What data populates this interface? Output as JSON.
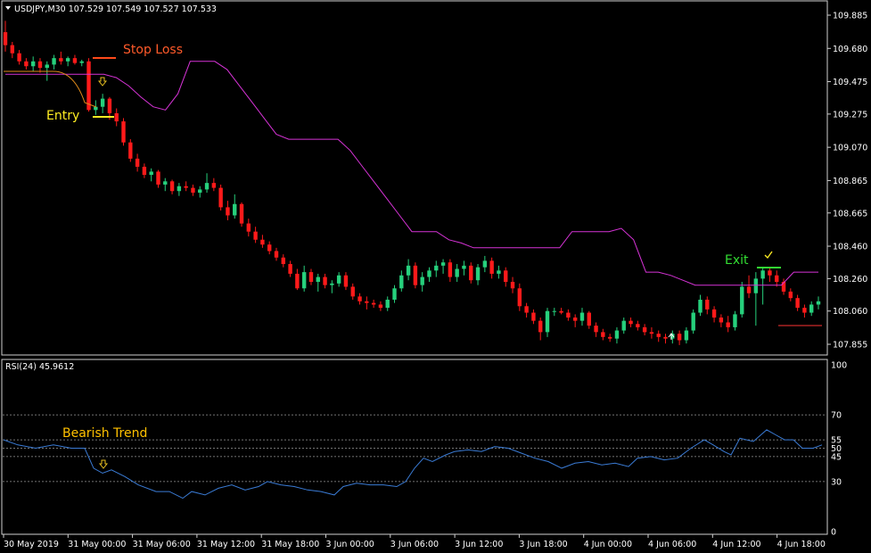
{
  "window": {
    "symbol_info": "USDJPY,M30  107.529 107.549 107.527 107.533",
    "dropdown_icon": "triangle-down-icon"
  },
  "price_axis": {
    "labels": [
      "109.885",
      "109.680",
      "109.475",
      "109.275",
      "109.070",
      "108.865",
      "108.665",
      "108.460",
      "108.260",
      "108.060",
      "107.855"
    ]
  },
  "time_axis": {
    "labels": [
      "30 May 2019",
      "31 May 00:00",
      "31 May 06:00",
      "31 May 12:00",
      "31 May 18:00",
      "3 Jun 00:00",
      "3 Jun 06:00",
      "3 Jun 12:00",
      "3 Jun 18:00",
      "4 Jun 00:00",
      "4 Jun 06:00",
      "4 Jun 12:00",
      "4 Jun 18:00"
    ]
  },
  "annotations": {
    "stop_loss": "Stop Loss",
    "entry": "Entry",
    "exit": "Exit",
    "bearish_trend": "Bearish Trend"
  },
  "indicator": {
    "title": "RSI(24) 45.9612",
    "levels": [
      "100",
      "70",
      "55",
      "50",
      "45",
      "30",
      "0"
    ]
  },
  "colors": {
    "bull": "#26d07c",
    "bear": "#ff1a1a",
    "trailing_stop": "#d633d6",
    "rsi_line": "#3a7bd5",
    "stop_loss_text": "#ff5a2a",
    "entry_text": "#ffee22",
    "exit_text": "#33dd33",
    "bearish_text": "#ffc000",
    "arrow": "#e8c020"
  },
  "chart_data": {
    "type": "candlestick",
    "symbol": "USDJPY",
    "timeframe": "M30",
    "ylim": [
      107.78,
      109.95
    ],
    "ohlc_estimated": [
      [
        109.78,
        109.85,
        109.66,
        109.7
      ],
      [
        109.7,
        109.72,
        109.62,
        109.65
      ],
      [
        109.65,
        109.67,
        109.58,
        109.6
      ],
      [
        109.6,
        109.62,
        109.55,
        109.57
      ],
      [
        109.57,
        109.63,
        109.54,
        109.6
      ],
      [
        109.6,
        109.62,
        109.53,
        109.56
      ],
      [
        109.56,
        109.6,
        109.48,
        109.58
      ],
      [
        109.58,
        109.64,
        109.55,
        109.62
      ],
      [
        109.62,
        109.66,
        109.58,
        109.6
      ],
      [
        109.6,
        109.63,
        109.57,
        109.62
      ],
      [
        109.62,
        109.64,
        109.58,
        109.59
      ],
      [
        109.59,
        109.61,
        109.57,
        109.6
      ],
      [
        109.6,
        109.62,
        109.29,
        109.3
      ],
      [
        109.3,
        109.36,
        109.27,
        109.32
      ],
      [
        109.32,
        109.4,
        109.28,
        109.37
      ],
      [
        109.37,
        109.38,
        109.24,
        109.28
      ],
      [
        109.28,
        109.31,
        109.2,
        109.23
      ],
      [
        109.23,
        109.25,
        109.08,
        109.1
      ],
      [
        109.1,
        109.12,
        108.98,
        109.0
      ],
      [
        109.0,
        109.03,
        108.92,
        108.95
      ],
      [
        108.95,
        108.97,
        108.88,
        108.9
      ],
      [
        108.9,
        108.94,
        108.86,
        108.92
      ],
      [
        108.92,
        108.93,
        108.82,
        108.84
      ],
      [
        108.84,
        108.88,
        108.8,
        108.86
      ],
      [
        108.86,
        108.87,
        108.78,
        108.8
      ],
      [
        108.8,
        108.85,
        108.77,
        108.83
      ],
      [
        108.83,
        108.86,
        108.8,
        108.82
      ],
      [
        108.82,
        108.84,
        108.77,
        108.79
      ],
      [
        108.79,
        108.83,
        108.76,
        108.81
      ],
      [
        108.81,
        108.91,
        108.79,
        108.85
      ],
      [
        108.85,
        108.88,
        108.8,
        108.82
      ],
      [
        108.82,
        108.84,
        108.68,
        108.7
      ],
      [
        108.7,
        108.74,
        108.62,
        108.65
      ],
      [
        108.65,
        108.78,
        108.63,
        108.72
      ],
      [
        108.72,
        108.73,
        108.58,
        108.6
      ],
      [
        108.6,
        108.63,
        108.52,
        108.55
      ],
      [
        108.55,
        108.58,
        108.48,
        108.5
      ],
      [
        108.5,
        108.53,
        108.45,
        108.47
      ],
      [
        108.47,
        108.49,
        108.41,
        108.43
      ],
      [
        108.43,
        108.45,
        108.37,
        108.39
      ],
      [
        108.39,
        108.41,
        108.33,
        108.35
      ],
      [
        108.35,
        108.37,
        108.27,
        108.29
      ],
      [
        108.29,
        108.32,
        108.19,
        108.2
      ],
      [
        108.2,
        108.34,
        108.18,
        108.3
      ],
      [
        108.3,
        108.32,
        108.22,
        108.24
      ],
      [
        108.24,
        108.29,
        108.18,
        108.27
      ],
      [
        108.27,
        108.29,
        108.2,
        108.22
      ],
      [
        108.22,
        108.25,
        108.17,
        108.23
      ],
      [
        108.23,
        108.3,
        108.21,
        108.28
      ],
      [
        108.28,
        108.3,
        108.19,
        108.21
      ],
      [
        108.21,
        108.23,
        108.13,
        108.15
      ],
      [
        108.15,
        108.17,
        108.1,
        108.12
      ],
      [
        108.12,
        108.15,
        108.07,
        108.11
      ],
      [
        108.11,
        108.13,
        108.08,
        108.1
      ],
      [
        108.1,
        108.12,
        108.06,
        108.08
      ],
      [
        108.08,
        108.15,
        108.06,
        108.13
      ],
      [
        108.13,
        108.22,
        108.11,
        108.2
      ],
      [
        108.2,
        108.31,
        108.18,
        108.28
      ],
      [
        108.28,
        108.38,
        108.25,
        108.34
      ],
      [
        108.34,
        108.36,
        108.2,
        108.22
      ],
      [
        108.22,
        108.3,
        108.18,
        108.27
      ],
      [
        108.27,
        108.33,
        108.24,
        108.31
      ],
      [
        108.31,
        108.37,
        108.27,
        108.34
      ],
      [
        108.34,
        108.38,
        108.29,
        108.36
      ],
      [
        108.36,
        108.38,
        108.24,
        108.27
      ],
      [
        108.27,
        108.35,
        108.24,
        108.32
      ],
      [
        108.32,
        108.37,
        108.28,
        108.34
      ],
      [
        108.34,
        108.36,
        108.23,
        108.25
      ],
      [
        108.25,
        108.35,
        108.22,
        108.33
      ],
      [
        108.33,
        108.4,
        108.3,
        108.37
      ],
      [
        108.37,
        108.39,
        108.26,
        108.29
      ],
      [
        108.29,
        108.34,
        108.26,
        108.31
      ],
      [
        108.31,
        108.33,
        108.21,
        108.24
      ],
      [
        108.24,
        108.27,
        108.17,
        108.2
      ],
      [
        108.2,
        108.23,
        108.06,
        108.09
      ],
      [
        108.09,
        108.11,
        108.02,
        108.05
      ],
      [
        108.05,
        108.07,
        107.98,
        108.0
      ],
      [
        108.0,
        108.02,
        107.88,
        107.93
      ],
      [
        107.93,
        108.08,
        107.9,
        108.06
      ],
      [
        108.06,
        108.08,
        108.03,
        108.06
      ],
      [
        108.06,
        108.08,
        108.04,
        108.05
      ],
      [
        108.05,
        108.07,
        108.0,
        108.02
      ],
      [
        108.02,
        108.04,
        107.96,
        108.0
      ],
      [
        108.0,
        108.08,
        107.97,
        108.05
      ],
      [
        108.05,
        108.06,
        107.95,
        107.97
      ],
      [
        107.97,
        107.99,
        107.9,
        107.93
      ],
      [
        107.93,
        107.95,
        107.88,
        107.9
      ],
      [
        107.9,
        107.92,
        107.87,
        107.89
      ],
      [
        107.89,
        107.96,
        107.86,
        107.94
      ],
      [
        107.94,
        108.02,
        107.92,
        108.0
      ],
      [
        108.0,
        108.02,
        107.96,
        107.98
      ],
      [
        107.98,
        108.0,
        107.94,
        107.96
      ],
      [
        107.96,
        107.98,
        107.91,
        107.93
      ],
      [
        107.93,
        107.96,
        107.89,
        107.92
      ],
      [
        107.92,
        107.94,
        107.87,
        107.9
      ],
      [
        107.9,
        107.92,
        107.86,
        107.89
      ],
      [
        107.89,
        107.94,
        107.86,
        107.92
      ],
      [
        107.92,
        107.94,
        107.85,
        107.88
      ],
      [
        107.88,
        107.96,
        107.86,
        107.94
      ],
      [
        107.94,
        108.07,
        107.92,
        108.05
      ],
      [
        108.05,
        108.16,
        108.03,
        108.13
      ],
      [
        108.13,
        108.15,
        108.04,
        108.07
      ],
      [
        108.07,
        108.09,
        107.99,
        108.02
      ],
      [
        108.02,
        108.04,
        107.96,
        107.99
      ],
      [
        107.99,
        108.03,
        107.93,
        107.96
      ],
      [
        107.96,
        108.06,
        107.94,
        108.04
      ],
      [
        108.04,
        108.24,
        108.02,
        108.21
      ],
      [
        108.21,
        108.28,
        108.14,
        108.17
      ],
      [
        108.17,
        108.3,
        107.97,
        108.26
      ],
      [
        108.26,
        108.33,
        108.1,
        108.31
      ],
      [
        108.31,
        108.33,
        108.24,
        108.28
      ],
      [
        108.28,
        108.31,
        108.21,
        108.24
      ],
      [
        108.24,
        108.26,
        108.16,
        108.18
      ],
      [
        108.18,
        108.2,
        108.12,
        108.14
      ],
      [
        108.14,
        108.16,
        108.06,
        108.08
      ],
      [
        108.08,
        108.1,
        108.02,
        108.05
      ],
      [
        108.05,
        108.12,
        108.03,
        108.1
      ],
      [
        108.1,
        108.15,
        108.07,
        108.12
      ]
    ],
    "trailing_stop_estimated": [
      109.52,
      109.52,
      109.52,
      109.52,
      109.52,
      109.52,
      109.52,
      109.52,
      109.52,
      109.5,
      109.45,
      109.38,
      109.32,
      109.3,
      109.4,
      109.6,
      109.6,
      109.6,
      109.55,
      109.45,
      109.35,
      109.25,
      109.15,
      109.12,
      109.12,
      109.12,
      109.12,
      109.12,
      109.05,
      108.95,
      108.85,
      108.75,
      108.65,
      108.55,
      108.55,
      108.55,
      108.5,
      108.48,
      108.45,
      108.45,
      108.45,
      108.45,
      108.45,
      108.45,
      108.45,
      108.45,
      108.55,
      108.55,
      108.55,
      108.55,
      108.57,
      108.5,
      108.3,
      108.3,
      108.28,
      108.25,
      108.22,
      108.22,
      108.22,
      108.22,
      108.22,
      108.22,
      108.22,
      108.22,
      108.3,
      108.3,
      108.3
    ],
    "rsi": {
      "period": 24,
      "current": 45.9612,
      "levels": [
        70,
        55,
        50,
        45,
        30
      ],
      "ylim": [
        0,
        100
      ]
    }
  }
}
